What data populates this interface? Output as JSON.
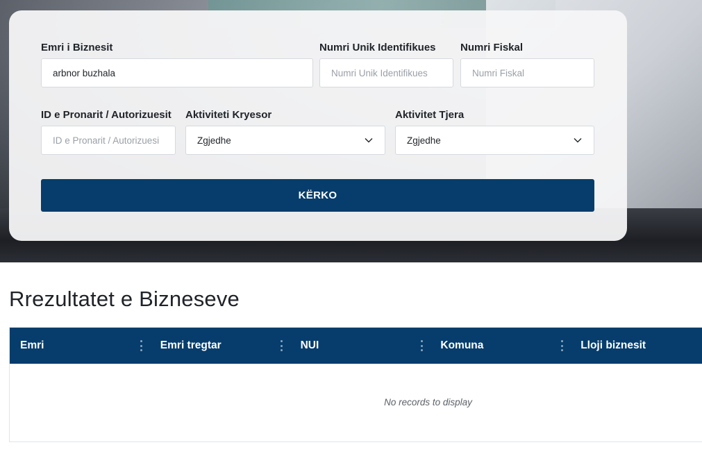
{
  "form": {
    "business_name": {
      "label": "Emri i Biznesit",
      "value": "arbnor buzhala",
      "placeholder": ""
    },
    "nui": {
      "label": "Numri Unik Identifikues",
      "value": "",
      "placeholder": "Numri Unik Identifikues"
    },
    "fiscal": {
      "label": "Numri Fiskal",
      "value": "",
      "placeholder": "Numri Fiskal"
    },
    "owner_id": {
      "label": "ID e Pronarit / Autorizuesit",
      "value": "",
      "placeholder": "ID e Pronarit / Autorizuesi"
    },
    "main_activity": {
      "label": "Aktiviteti Kryesor",
      "selected": "Zgjedhe"
    },
    "other_activities": {
      "label": "Aktivitet Tjera",
      "selected": "Zgjedhe"
    },
    "search_label": "KËRKO"
  },
  "results": {
    "title": "Rrezultatet e Bizneseve",
    "columns": [
      "Emri",
      "Emri tregtar",
      "NUI",
      "Komuna",
      "Lloji biznesit"
    ],
    "empty_message": "No records to display"
  },
  "colors": {
    "primary": "#063d6c",
    "card_bg": "#f6f6f7"
  },
  "icons": {
    "dropdown": "chevron-down-icon",
    "column_menu": "kebab-menu-icon"
  }
}
